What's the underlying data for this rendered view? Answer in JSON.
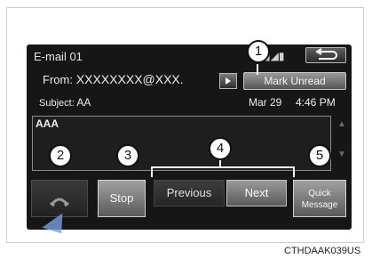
{
  "screen": {
    "title": "E-mail 01",
    "status_icons": "▮◢▮",
    "back_icon": "return-arrow-icon"
  },
  "header": {
    "from_label": "From:",
    "from_value": "XXXXXXXX@XXX.",
    "mark_unread_label": "Mark Unread",
    "subject_label": "Subject:",
    "subject_value": "AA",
    "date": "Mar 29",
    "time": "4:46 PM"
  },
  "message": {
    "body": "AAA"
  },
  "controls": {
    "stop_label": "Stop",
    "previous_label": "Previous",
    "next_label": "Next",
    "quick_message_line1": "Quick",
    "quick_message_line2": "Message"
  },
  "callouts": [
    "1",
    "2",
    "3",
    "4",
    "5"
  ],
  "caption": "CTHDAAK039US"
}
